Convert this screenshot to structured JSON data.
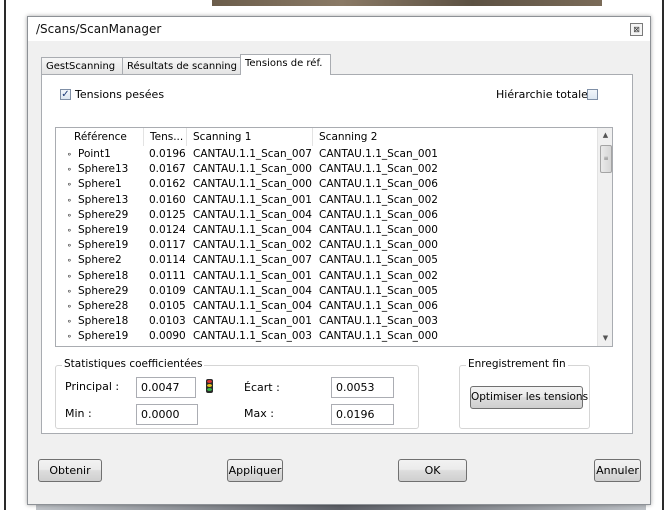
{
  "dialog": {
    "title": "/Scans/ScanManager",
    "close_glyph": "⊠",
    "close_icon": "close-icon"
  },
  "tabs": [
    {
      "label": "GestScanning",
      "active": false
    },
    {
      "label": "Résultats de scanning",
      "active": false
    },
    {
      "label": "Tensions de réf.",
      "active": true
    }
  ],
  "options": {
    "weighted_tensions_label": "Tensions pesées",
    "weighted_tensions_checked": true,
    "full_hierarchy_label": "Hiérarchie totale",
    "full_hierarchy_checked": false
  },
  "table": {
    "columns": [
      "Référence",
      "Tens...",
      "Scanning 1",
      "Scanning 2"
    ],
    "row_icon": "point-icon",
    "rows": [
      {
        "ref": "Point1",
        "tension": "0.0196",
        "scan1": "CANTAU.1.1_Scan_007",
        "scan2": "CANTAU.1.1_Scan_001"
      },
      {
        "ref": "Sphere13",
        "tension": "0.0167",
        "scan1": "CANTAU.1.1_Scan_000",
        "scan2": "CANTAU.1.1_Scan_002"
      },
      {
        "ref": "Sphere1",
        "tension": "0.0162",
        "scan1": "CANTAU.1.1_Scan_000",
        "scan2": "CANTAU.1.1_Scan_006"
      },
      {
        "ref": "Sphere13",
        "tension": "0.0160",
        "scan1": "CANTAU.1.1_Scan_001",
        "scan2": "CANTAU.1.1_Scan_002"
      },
      {
        "ref": "Sphere29",
        "tension": "0.0125",
        "scan1": "CANTAU.1.1_Scan_004",
        "scan2": "CANTAU.1.1_Scan_006"
      },
      {
        "ref": "Sphere19",
        "tension": "0.0124",
        "scan1": "CANTAU.1.1_Scan_004",
        "scan2": "CANTAU.1.1_Scan_000"
      },
      {
        "ref": "Sphere19",
        "tension": "0.0117",
        "scan1": "CANTAU.1.1_Scan_002",
        "scan2": "CANTAU.1.1_Scan_000"
      },
      {
        "ref": "Sphere2",
        "tension": "0.0114",
        "scan1": "CANTAU.1.1_Scan_007",
        "scan2": "CANTAU.1.1_Scan_005"
      },
      {
        "ref": "Sphere18",
        "tension": "0.0111",
        "scan1": "CANTAU.1.1_Scan_001",
        "scan2": "CANTAU.1.1_Scan_002"
      },
      {
        "ref": "Sphere29",
        "tension": "0.0109",
        "scan1": "CANTAU.1.1_Scan_004",
        "scan2": "CANTAU.1.1_Scan_005"
      },
      {
        "ref": "Sphere28",
        "tension": "0.0105",
        "scan1": "CANTAU.1.1_Scan_004",
        "scan2": "CANTAU.1.1_Scan_006"
      },
      {
        "ref": "Sphere18",
        "tension": "0.0103",
        "scan1": "CANTAU.1.1_Scan_001",
        "scan2": "CANTAU.1.1_Scan_003"
      },
      {
        "ref": "Sphere19",
        "tension": "0.0090",
        "scan1": "CANTAU.1.1_Scan_003",
        "scan2": "CANTAU.1.1_Scan_000"
      }
    ]
  },
  "stats": {
    "group_title": "Statistiques coefficientées",
    "principal_label": "Principal :",
    "principal_value": "0.0047",
    "ecart_label": "Écart :",
    "ecart_value": "0.0053",
    "min_label": "Min :",
    "min_value": "0.0000",
    "max_label": "Max :",
    "max_value": "0.0196",
    "status_icon": "traffic-light-icon"
  },
  "fine_registration": {
    "group_title": "Enregistrement fin",
    "optimize_button": "Optimiser les tensions"
  },
  "footer": {
    "get_button": "Obtenir",
    "apply_button": "Appliquer",
    "ok_button": "OK",
    "cancel_button": "Annuler"
  },
  "colors": {
    "selected_tab": "#ffffff",
    "window_bg": "#f0f0f0",
    "check_mark": "#1e3c78"
  }
}
